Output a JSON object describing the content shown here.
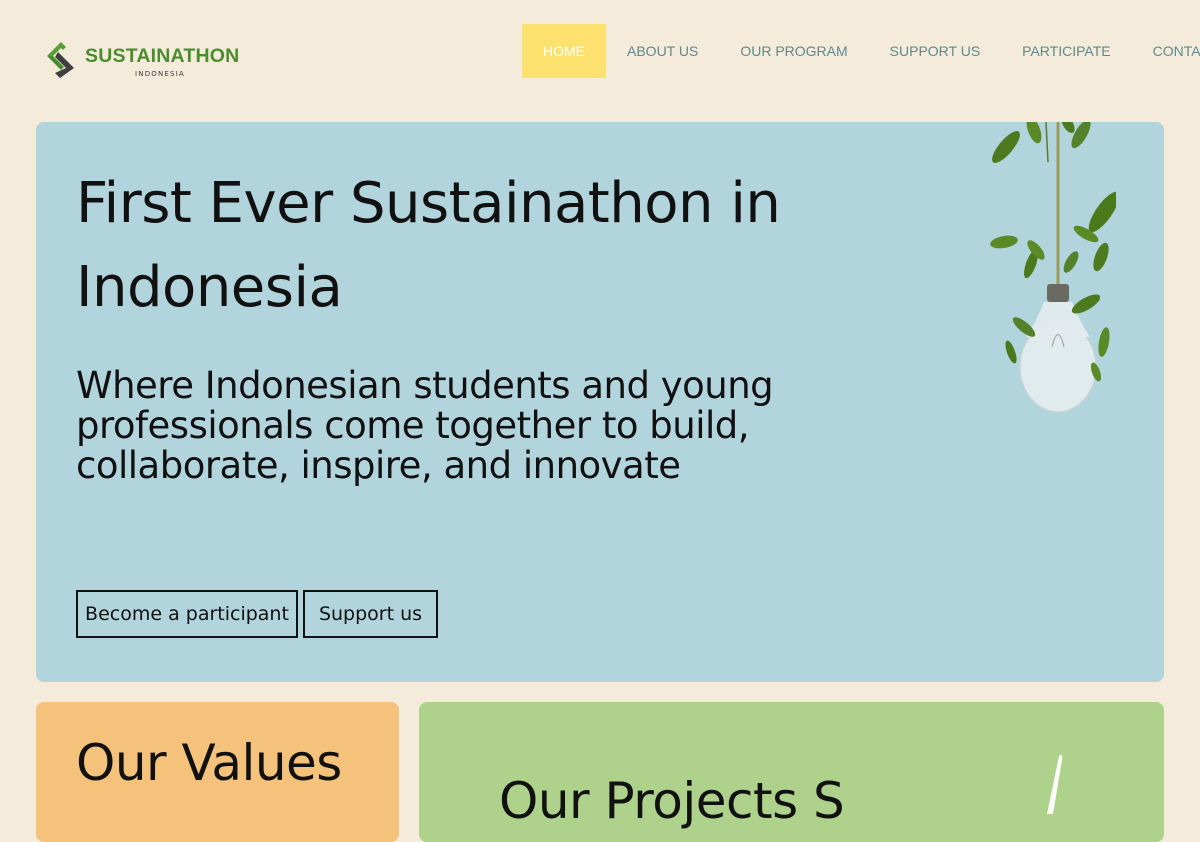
{
  "brand": {
    "title": "SUSTAINATHON",
    "subtitle": "INDONESIA",
    "logo_icon": "logo-mark-icon",
    "color_green": "#4a8d2e"
  },
  "nav": {
    "items": [
      {
        "label": "HOME",
        "active": true
      },
      {
        "label": "ABOUT US",
        "active": false
      },
      {
        "label": "OUR PROGRAM",
        "active": false
      },
      {
        "label": "SUPPORT US",
        "active": false
      },
      {
        "label": "PARTICIPATE",
        "active": false
      },
      {
        "label": "CONTACT",
        "active": false
      }
    ],
    "active_color": "#fce16f"
  },
  "hero": {
    "title": "First Ever Sustainathon in Indonesia",
    "subtitle": "Where Indonesian students and young professionals come together to build, collaborate, inspire, and innovate",
    "buttons": {
      "participant": "Become a participant",
      "support": "Support us"
    },
    "image_icon": "hanging-lightbulb-plant-icon",
    "background": "#b2d4dd"
  },
  "sections": {
    "values_title": "Our Values",
    "projects_title": "Our Projects S",
    "values_background": "#f5c27b",
    "projects_background": "#aed28c"
  }
}
